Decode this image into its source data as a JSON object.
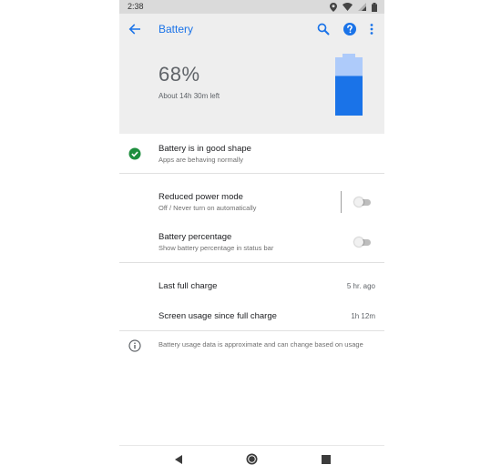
{
  "status_bar": {
    "time": "2:38"
  },
  "app_bar": {
    "title": "Battery"
  },
  "summary": {
    "percent": "68%",
    "time_left": "About 14h 30m left",
    "level": 0.68
  },
  "tip": {
    "title": "Battery is in good shape",
    "subtitle": "Apps are behaving normally"
  },
  "settings": [
    {
      "title": "Reduced power mode",
      "subtitle": "Off / Never turn on automatically",
      "enabled": false
    },
    {
      "title": "Battery percentage",
      "subtitle": "Show battery percentage in status bar",
      "enabled": false
    }
  ],
  "usage": [
    {
      "label": "Last full charge",
      "value": "5 hr. ago"
    },
    {
      "label": "Screen usage since full charge",
      "value": "1h 12m"
    }
  ],
  "footer": {
    "info": "Battery usage data is approximate and can change based on usage"
  },
  "colors": {
    "accent": "#1a73e8",
    "battery_fill": "#1a73e8",
    "battery_empty": "#aecbfa",
    "good_status": "#1e8e3e"
  }
}
